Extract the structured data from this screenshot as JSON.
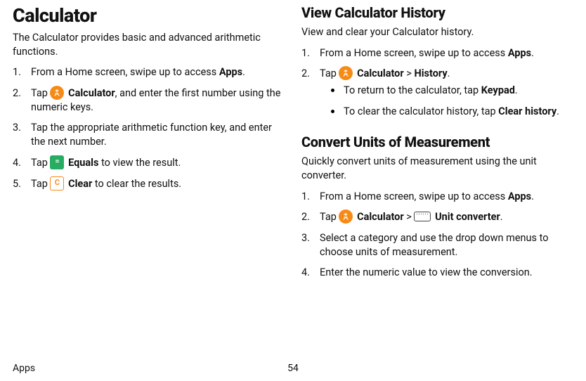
{
  "left": {
    "title": "Calculator",
    "intro": "The Calculator provides basic and advanced arithmetic functions.",
    "steps": {
      "s1_a": "From a Home screen, swipe up to access ",
      "s1_b": "Apps",
      "s1_c": ".",
      "s2_a": "Tap ",
      "s2_b": "Calculator",
      "s2_c": ", and enter the first number using the numeric keys.",
      "s3": "Tap the appropriate arithmetic function key, and enter the next number.",
      "s4_a": "Tap ",
      "s4_b": "Equals",
      "s4_c": " to view the result.",
      "s5_a": "Tap ",
      "s5_b": "Clear",
      "s5_c": " to clear the results."
    },
    "icons": {
      "equals_glyph": "=",
      "clear_glyph": "C"
    }
  },
  "right": {
    "history": {
      "title": "View Calculator History",
      "intro": "View and clear your Calculator history.",
      "s1_a": "From a Home screen, swipe up to access ",
      "s1_b": "Apps",
      "s1_c": ".",
      "s2_a": "Tap ",
      "s2_b": "Calculator",
      "s2_c": " > ",
      "s2_d": "History",
      "s2_e": ".",
      "b1_a": "To return to the calculator, tap ",
      "b1_b": "Keypad",
      "b1_c": ".",
      "b2_a": "To clear the calculator history, tap ",
      "b2_b": "Clear history",
      "b2_c": "."
    },
    "convert": {
      "title": "Convert Units of Measurement",
      "intro": "Quickly convert units of measurement using the unit converter.",
      "s1_a": "From a Home screen, swipe up to access ",
      "s1_b": "Apps",
      "s1_c": ".",
      "s2_a": "Tap ",
      "s2_b": "Calculator",
      "s2_c": " > ",
      "s2_d": "Unit converter",
      "s2_e": ".",
      "s3": "Select a category and use the drop down menus to choose units of measurement.",
      "s4": "Enter the numeric value to view the conversion."
    }
  },
  "footer": {
    "section": "Apps",
    "page": "54"
  }
}
